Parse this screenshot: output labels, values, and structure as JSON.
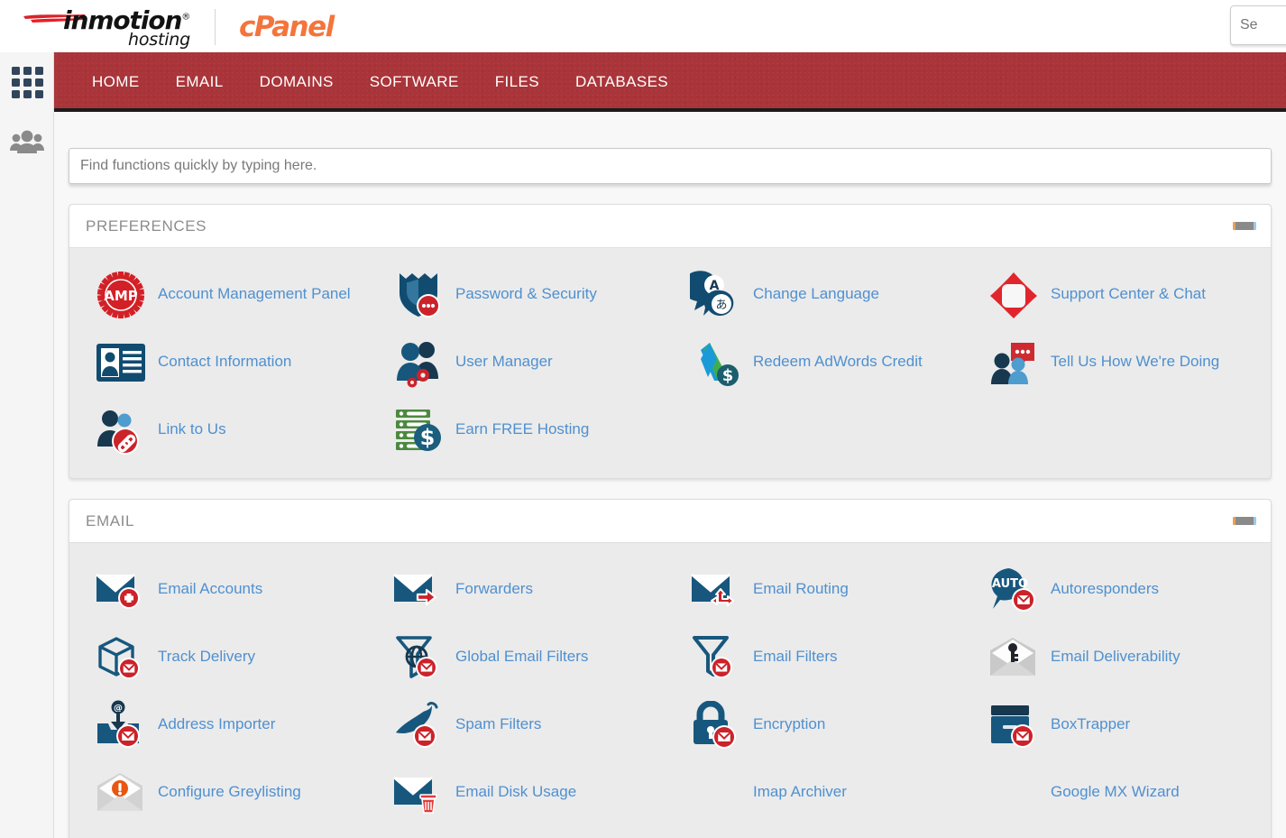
{
  "brand": {
    "imh_word": "inmotion",
    "imh_reg": "®",
    "imh_sub": "hosting",
    "cpanel_word": "cPanel"
  },
  "top_search": {
    "value": "",
    "placeholder": "Se"
  },
  "rail": {
    "items": [
      {
        "name": "apps-grid",
        "icon": "grid-icon"
      },
      {
        "name": "user-manager",
        "icon": "people-icon"
      }
    ]
  },
  "nav": {
    "items": [
      {
        "label": "HOME"
      },
      {
        "label": "EMAIL"
      },
      {
        "label": "DOMAINS"
      },
      {
        "label": "SOFTWARE"
      },
      {
        "label": "FILES"
      },
      {
        "label": "DATABASES"
      }
    ]
  },
  "search": {
    "value": "",
    "placeholder": "Find functions quickly by typing here."
  },
  "sections": [
    {
      "title": "PREFERENCES",
      "collapse_label": "−",
      "tiles": [
        {
          "label": "Account Management Panel",
          "icon": "amp-badge-icon"
        },
        {
          "label": "Password & Security",
          "icon": "shield-password-icon"
        },
        {
          "label": "Change Language",
          "icon": "language-bubbles-icon"
        },
        {
          "label": "Support Center & Chat",
          "icon": "support-diamond-icon"
        },
        {
          "label": "Contact Information",
          "icon": "id-card-icon"
        },
        {
          "label": "User Manager",
          "icon": "users-gears-icon"
        },
        {
          "label": "Redeem AdWords Credit",
          "icon": "adwords-dollar-icon"
        },
        {
          "label": "Tell Us How We're Doing",
          "icon": "feedback-chat-icon"
        },
        {
          "label": "Link to Us",
          "icon": "user-link-icon"
        },
        {
          "label": "Earn FREE Hosting",
          "icon": "server-dollar-icon"
        }
      ]
    },
    {
      "title": "EMAIL",
      "collapse_label": "−",
      "tiles": [
        {
          "label": "Email Accounts",
          "icon": "envelope-plus-icon"
        },
        {
          "label": "Forwarders",
          "icon": "envelope-arrow-icon"
        },
        {
          "label": "Email Routing",
          "icon": "envelope-routing-icon"
        },
        {
          "label": "Autoresponders",
          "icon": "auto-bubble-icon"
        },
        {
          "label": "Track Delivery",
          "icon": "box-envelope-icon"
        },
        {
          "label": "Global Email Filters",
          "icon": "funnel-globe-icon"
        },
        {
          "label": "Email Filters",
          "icon": "funnel-envelope-icon"
        },
        {
          "label": "Email Deliverability",
          "icon": "envelope-key-icon"
        },
        {
          "label": "Address Importer",
          "icon": "import-at-icon"
        },
        {
          "label": "Spam Filters",
          "icon": "spam-pepper-icon"
        },
        {
          "label": "Encryption",
          "icon": "lock-envelope-icon"
        },
        {
          "label": "BoxTrapper",
          "icon": "boxtrapper-icon"
        },
        {
          "label": "Configure Greylisting",
          "icon": "envelope-alert-icon"
        },
        {
          "label": "Email Disk Usage",
          "icon": "envelope-trash-icon"
        },
        {
          "label": "Imap Archiver",
          "icon": "none"
        },
        {
          "label": "Google MX Wizard",
          "icon": "none"
        }
      ]
    }
  ],
  "colors": {
    "nav_red": "#a93439",
    "link_blue": "#4f90d0",
    "icon_navy": "#17577e",
    "icon_red": "#cc2229",
    "cpanel_orange": "#f4743b",
    "rail_gray": "#f5f5f5",
    "card_gray": "#ebebeb"
  }
}
